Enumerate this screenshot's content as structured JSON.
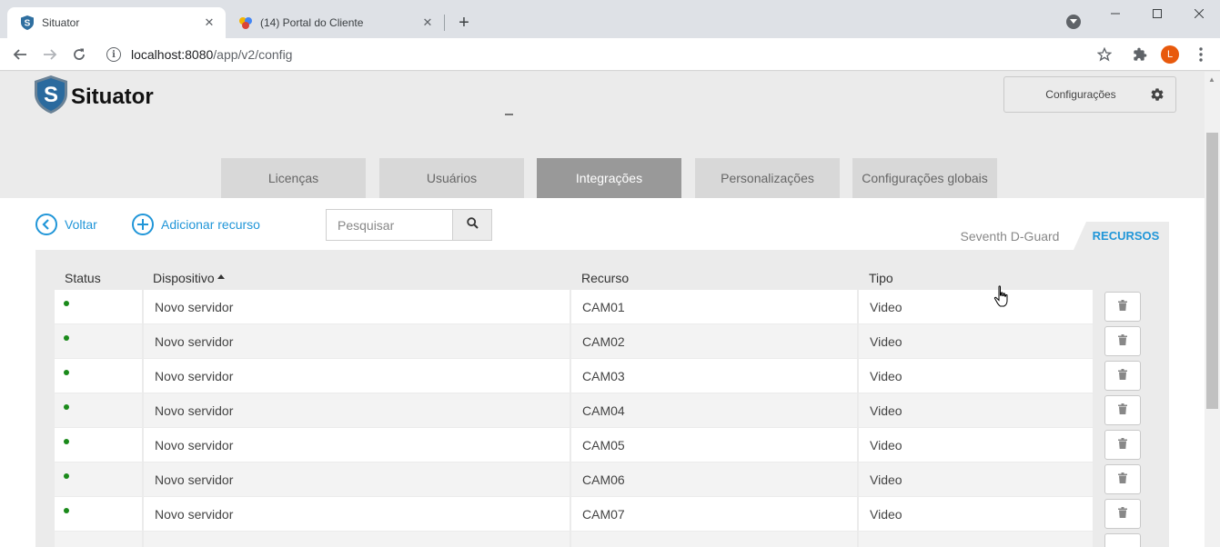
{
  "browser": {
    "tabs": [
      {
        "title": "Situator"
      },
      {
        "title": "(14) Portal do Cliente"
      }
    ],
    "url": {
      "host": "localhost:8080",
      "path": "/app/v2/config"
    },
    "profile_initial": "L"
  },
  "header": {
    "app_name": "Situator",
    "config_button": "Configurações"
  },
  "main_tabs": [
    {
      "label": "Licenças",
      "active": false
    },
    {
      "label": "Usuários",
      "active": false
    },
    {
      "label": "Integrações",
      "active": true
    },
    {
      "label": "Personalizações",
      "active": false
    },
    {
      "label": "Configurações globais",
      "active": false
    }
  ],
  "actions": {
    "back": "Voltar",
    "add_resource": "Adicionar recurso"
  },
  "search": {
    "placeholder": "Pesquisar",
    "value": ""
  },
  "subtabs": {
    "integration": "Seventh D-Guard",
    "resources": "RECURSOS"
  },
  "table": {
    "columns": {
      "status": "Status",
      "device": "Dispositivo",
      "resource": "Recurso",
      "type": "Tipo"
    },
    "sort": {
      "column": "Dispositivo",
      "direction": "asc"
    },
    "rows": [
      {
        "status": "online",
        "device": "Novo servidor",
        "resource": "CAM01",
        "type": "Video"
      },
      {
        "status": "online",
        "device": "Novo servidor",
        "resource": "CAM02",
        "type": "Video"
      },
      {
        "status": "online",
        "device": "Novo servidor",
        "resource": "CAM03",
        "type": "Video"
      },
      {
        "status": "online",
        "device": "Novo servidor",
        "resource": "CAM04",
        "type": "Video"
      },
      {
        "status": "online",
        "device": "Novo servidor",
        "resource": "CAM05",
        "type": "Video"
      },
      {
        "status": "online",
        "device": "Novo servidor",
        "resource": "CAM06",
        "type": "Video"
      },
      {
        "status": "online",
        "device": "Novo servidor",
        "resource": "CAM07",
        "type": "Video"
      }
    ]
  },
  "colors": {
    "accent": "#2196d8",
    "status_online": "#1a8a1a",
    "active_tab": "#999999"
  }
}
